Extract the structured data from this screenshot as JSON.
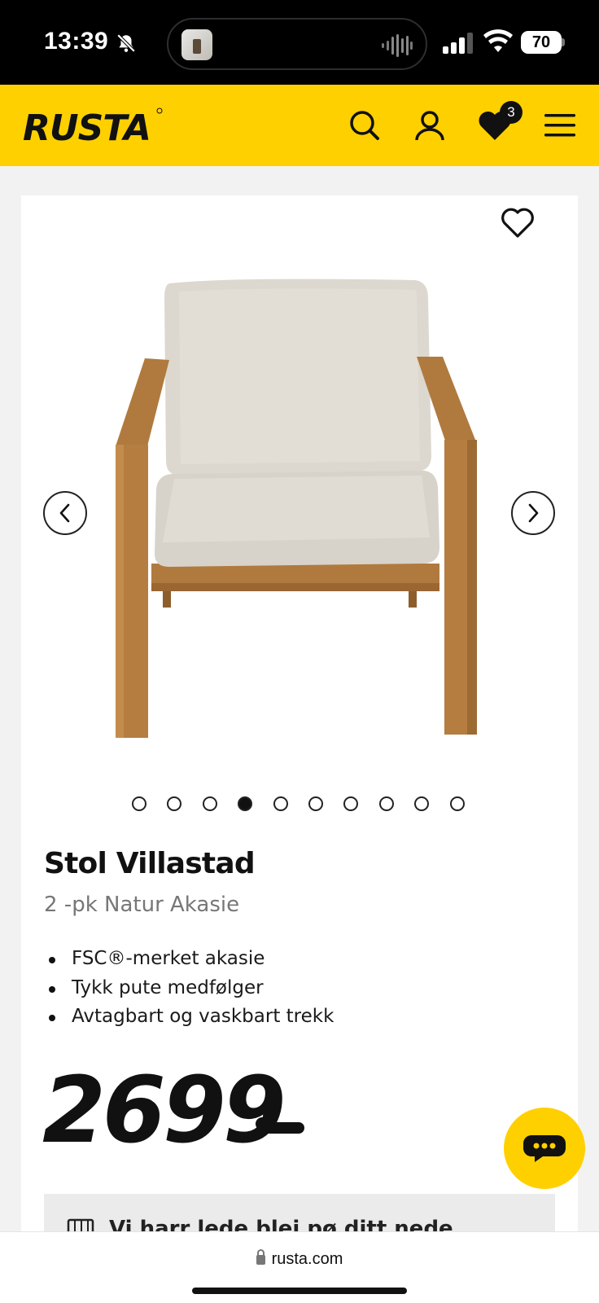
{
  "status_bar": {
    "time": "13:39",
    "battery": "70",
    "icons": [
      "bell-slash-icon",
      "signal-icon",
      "wifi-icon",
      "battery-icon"
    ]
  },
  "header": {
    "logo": "RUSTA",
    "cart_count": "3",
    "icons": [
      "search-icon",
      "account-icon",
      "heart-icon",
      "menu-icon"
    ],
    "bg_color": "#ffd000"
  },
  "product": {
    "title": "Stol Villastad",
    "subtitle": "2 -pk Natur Akasie",
    "features": [
      "FSC®-merket akasie",
      "Tykk pute medfølger",
      "Avtagbart og vaskbart trekk"
    ],
    "price": "2699",
    "carousel": {
      "total": 10,
      "active_index": 3
    }
  },
  "delivery": {
    "text": "Vi harr lede blei pø ditt nede..."
  },
  "browser": {
    "url": "rusta.com"
  }
}
